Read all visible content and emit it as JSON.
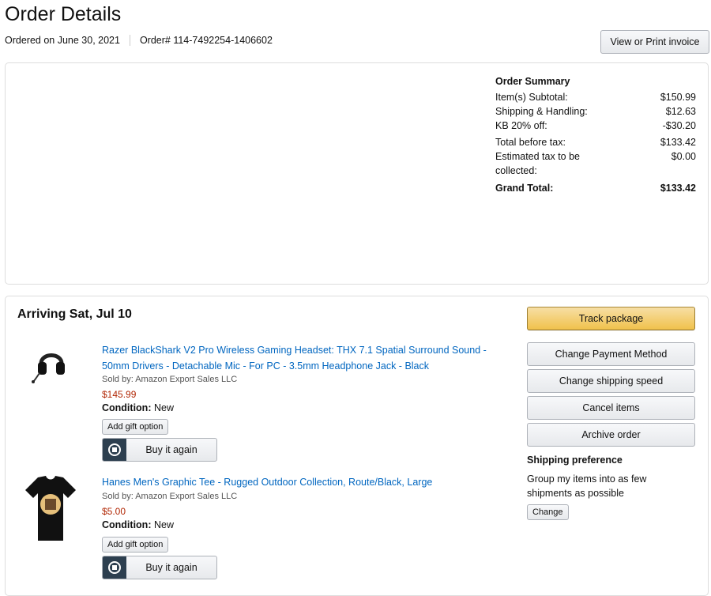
{
  "header": {
    "title": "Order Details",
    "ordered_on": "Ordered on June 30, 2021",
    "order_number": "Order# 114-7492254-1406602",
    "invoice_button": "View or Print invoice"
  },
  "summary": {
    "title": "Order Summary",
    "rows": [
      {
        "label": "Item(s) Subtotal:",
        "value": "$150.99"
      },
      {
        "label": "Shipping & Handling:",
        "value": "$12.63"
      },
      {
        "label": "KB 20% off:",
        "value": "-$30.20"
      },
      {
        "label": "Total before tax:",
        "value": "$133.42"
      },
      {
        "label": "Estimated tax to be collected:",
        "value": "$0.00"
      }
    ],
    "grand_total_label": "Grand Total:",
    "grand_total_value": "$133.42"
  },
  "shipment": {
    "arriving": "Arriving Sat, Jul 10",
    "items": [
      {
        "title": "Razer BlackShark V2 Pro Wireless Gaming Headset: THX 7.1 Spatial Surround Sound - 50mm Drivers - Detachable Mic - For PC - 3.5mm Headphone Jack - Black",
        "sold_by": "Sold by: Amazon Export Sales LLC",
        "price": "$145.99",
        "condition_label": "Condition:",
        "condition_value": "New",
        "gift_button": "Add gift option",
        "buy_again": "Buy it again",
        "image_icon": "headset-icon"
      },
      {
        "title": "Hanes Men's Graphic Tee - Rugged Outdoor Collection, Route/Black, Large",
        "sold_by": "Sold by: Amazon Export Sales LLC",
        "price": "$5.00",
        "condition_label": "Condition:",
        "condition_value": "New",
        "gift_button": "Add gift option",
        "buy_again": "Buy it again",
        "image_icon": "tshirt-icon"
      }
    ],
    "actions": {
      "track": "Track package",
      "change_payment": "Change Payment Method",
      "change_speed": "Change shipping speed",
      "cancel": "Cancel items",
      "archive": "Archive order"
    },
    "shipping_preference": {
      "title": "Shipping preference",
      "text": "Group my items into as few shipments as possible",
      "change_button": "Change"
    }
  },
  "colors": {
    "link": "#0066c0",
    "price": "#b12704",
    "track_button": "#f0c14b"
  }
}
